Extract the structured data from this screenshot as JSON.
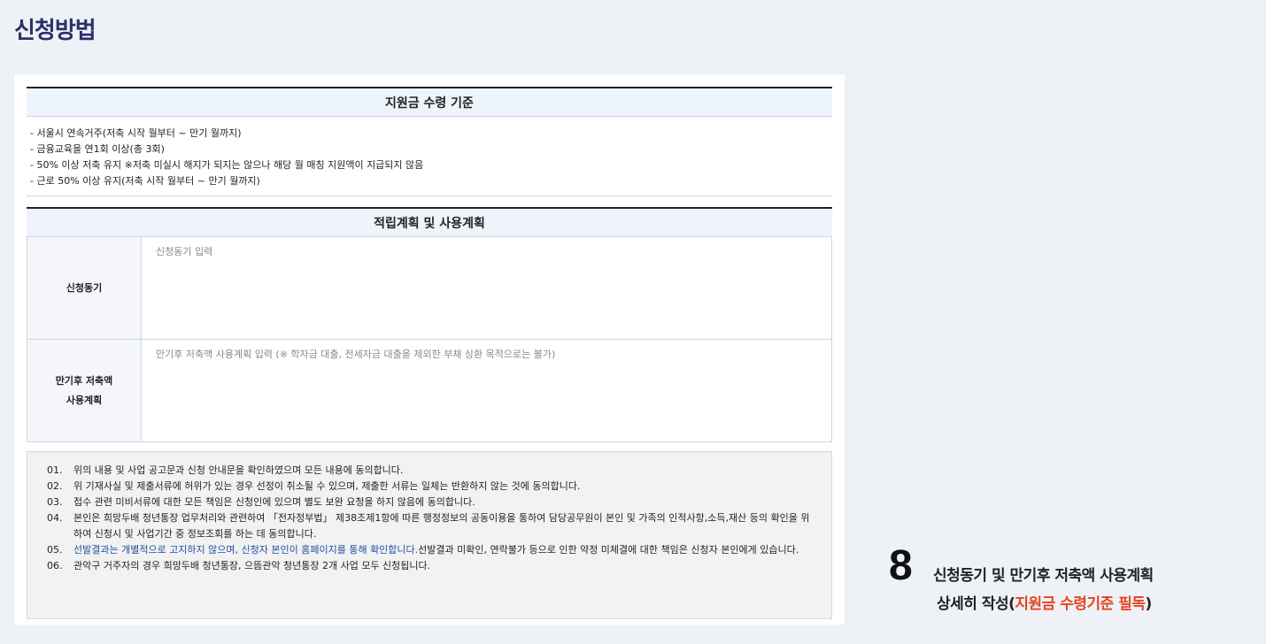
{
  "page_title": "신청방법",
  "criteria": {
    "header": "지원금 수령 기준",
    "lines": [
      "- 서울시 연속거주(저축 시작 월부터 ~ 만기 월까지)",
      "- 금융교육을 연1회 이상(총 3회)",
      "- 50% 이상 저축 유지 ※저축 미실시 해지가 되지는 않으나 해당 월 매칭 지원액이 지급되지 않음",
      "- 근로 50% 이상 유지(저축 시작 월부터 ~ 만기 월까지)"
    ]
  },
  "plan": {
    "header": "적립계획 및 사용계획",
    "motive_label": "신청동기",
    "motive_placeholder": "신청동기 입력",
    "usage_label": "만기후 저축액\n사용계획",
    "usage_placeholder": "만기후 저축액 사용계획 입력 (※ 학자금 대출, 전세자금 대출을 제외한 부채 상환 목적으로는 불가)"
  },
  "agreements": [
    {
      "num": "01.",
      "text": "위의 내용 및 사업 공고문과 신청 안내문을 확인하였으며 모든 내용에 동의합니다."
    },
    {
      "num": "02.",
      "text": "위 기재사실 및 제출서류에 허위가 있는 경우 선정이 취소될 수 있으며, 제출한 서류는 일체는 반환하지 않는 것에 동의합니다."
    },
    {
      "num": "03.",
      "text": "접수 관련 미비서류에 대한 모든 책임은 신청인에 있으며 별도 보완 요청을 하지 않음에 동의합니다."
    },
    {
      "num": "04.",
      "text": "본인은 희망두배 청년통장 업무처리와 관련하여 「전자정부법」 제38조제1항에 따른 행정정보의 공동이용을 통하여 담당공무원이 본인 및 가족의 인적사항,소득,재산 등의 확인을 위하여 신청시 및 사업기간 중 정보조회를 하는 데 동의합니다."
    },
    {
      "num": "05.",
      "highlight": "선발결과는 개별적으로 고지하지 않으며, 신청자 본인이 홈페이지를 통해 확인합니다.",
      "text": "선발결과 미확인, 연락불가 등으로 인한 약정 미체결에 대한 책임은 신청자 본인에게 있습니다."
    },
    {
      "num": "06.",
      "text": "관악구 거주자의 경우 희망두배 청년통장, 으뜸관악 청년통장 2개 사업 모두 신청됩니다."
    }
  ],
  "note": {
    "number": "8",
    "line1": "신청동기 및 만기후 저축액 사용계획",
    "line2_prefix": "상세히 작성(",
    "line2_highlight": "지원금 수령기준 필독",
    "line2_suffix": ")"
  },
  "colors": {
    "title": "#2b2f6b",
    "header_bg": "#eef4fb",
    "highlight_blue": "#1e50a0",
    "highlight_red": "#e8431e"
  }
}
